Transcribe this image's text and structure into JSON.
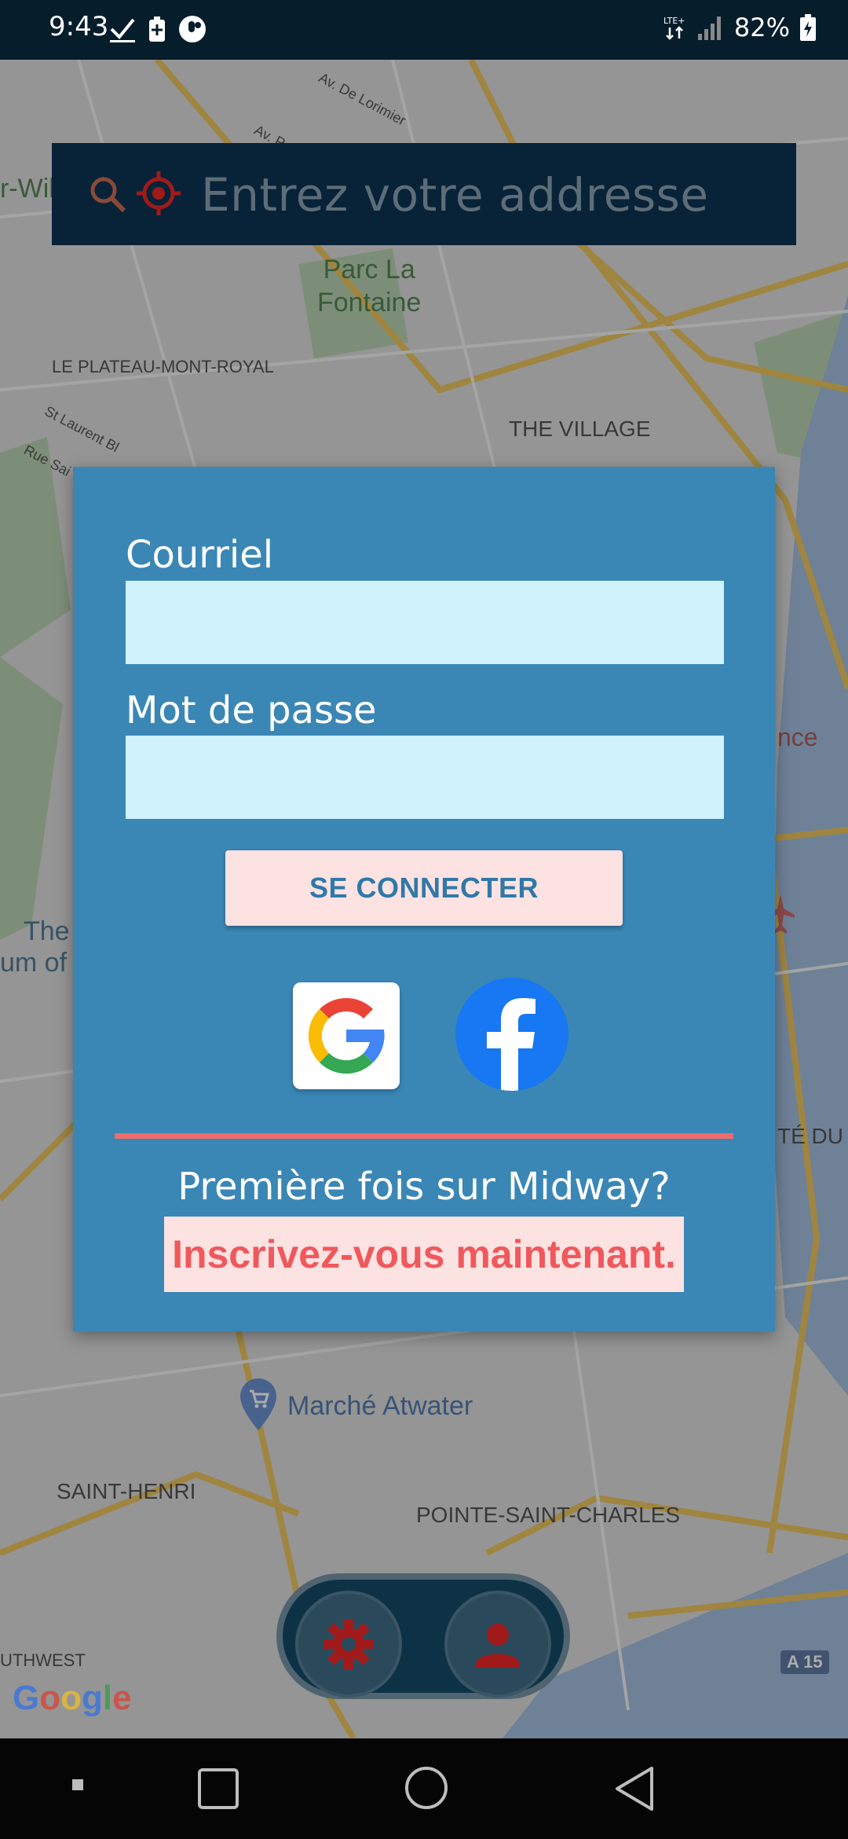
{
  "status_bar": {
    "time": "9:43",
    "battery": "82%",
    "icons": [
      "check-icon",
      "battery-saver-icon",
      "app-icon",
      "lte-icon",
      "signal-icon",
      "battery-icon"
    ]
  },
  "search": {
    "placeholder": "Entrez votre addresse"
  },
  "map": {
    "labels": {
      "parc": "Parc La\nFontaine",
      "plateau": "LE PLATEAU-MONT-ROYAL",
      "village": "THE VILLAGE",
      "marche": "Marché Atwater",
      "saint_henri": "SAINT-HENRI",
      "pointe": "POINTE-SAINT-CHARLES",
      "southwest": "UTHWEST",
      "av_lorimier": "Av. De Lorimier",
      "av_pa": "Av. Pa",
      "st_laurent": "St Laurent Bl",
      "rue_sai": "Rue Sai",
      "wil": "r-Wil",
      "the": "The",
      "um_of": "um of",
      "nce": "nce",
      "te_du_h": "TÉ DU H",
      "a15": "A 15"
    },
    "google_logo": "Google"
  },
  "login": {
    "email_label": "Courriel",
    "password_label": "Mot de passe",
    "submit_label": "SE CONNECTER",
    "first_time_text": "Première fois sur Midway?",
    "signup_label": "Inscrivez-vous maintenant."
  },
  "colors": {
    "card": "#3a87b6",
    "input": "#cff2fc",
    "button_bg": "#fde2e2",
    "accent_red": "#f06c6c",
    "search_bg": "#082338"
  }
}
